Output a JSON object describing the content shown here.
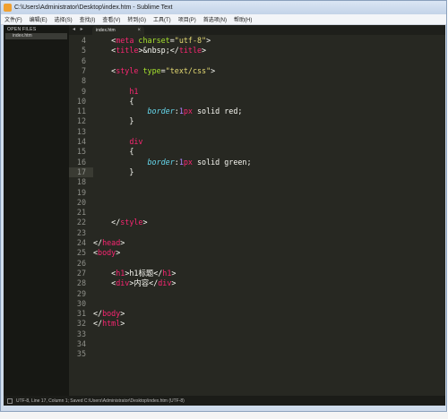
{
  "window": {
    "title": "C:\\Users\\Administrator\\Desktop\\index.htm - Sublime Text"
  },
  "menu": [
    "文件(F)",
    "编辑(E)",
    "选择(S)",
    "查找(I)",
    "查看(V)",
    "转到(G)",
    "工具(T)",
    "项目(P)",
    "首选项(N)",
    "帮助(H)"
  ],
  "sidebar": {
    "header": "OPEN FILES",
    "files": [
      "index.htm"
    ]
  },
  "tabs": {
    "arrows": "◂ ▸",
    "active": "index.htm",
    "close": "×"
  },
  "editor": {
    "current_line": 17,
    "lines": [
      {
        "n": "4",
        "tokens": [
          {
            "t": "    ",
            "c": "plain"
          },
          {
            "t": "<",
            "c": "plain"
          },
          {
            "t": "meta",
            "c": "tag"
          },
          {
            "t": " charset",
            "c": "attr"
          },
          {
            "t": "=",
            "c": "plain"
          },
          {
            "t": "\"utf-8\"",
            "c": "str"
          },
          {
            "t": ">",
            "c": "plain"
          }
        ]
      },
      {
        "n": "5",
        "tokens": [
          {
            "t": "    ",
            "c": "plain"
          },
          {
            "t": "<",
            "c": "plain"
          },
          {
            "t": "title",
            "c": "tag"
          },
          {
            "t": ">&nbsp;</",
            "c": "plain"
          },
          {
            "t": "title",
            "c": "tag"
          },
          {
            "t": ">",
            "c": "plain"
          }
        ]
      },
      {
        "n": "6",
        "tokens": []
      },
      {
        "n": "7",
        "tokens": [
          {
            "t": "    ",
            "c": "plain"
          },
          {
            "t": "<",
            "c": "plain"
          },
          {
            "t": "style",
            "c": "tag"
          },
          {
            "t": " type",
            "c": "attr"
          },
          {
            "t": "=",
            "c": "plain"
          },
          {
            "t": "\"text/css\"",
            "c": "str"
          },
          {
            "t": ">",
            "c": "plain"
          }
        ]
      },
      {
        "n": "8",
        "tokens": []
      },
      {
        "n": "9",
        "tokens": [
          {
            "t": "        ",
            "c": "plain"
          },
          {
            "t": "h1",
            "c": "tag"
          }
        ]
      },
      {
        "n": "10",
        "tokens": [
          {
            "t": "        {",
            "c": "plain"
          }
        ]
      },
      {
        "n": "11",
        "tokens": [
          {
            "t": "            ",
            "c": "plain"
          },
          {
            "t": "border",
            "c": "prop"
          },
          {
            "t": ":",
            "c": "plain"
          },
          {
            "t": "1",
            "c": "num"
          },
          {
            "t": "px",
            "c": "tag"
          },
          {
            "t": " solid red;",
            "c": "plain"
          }
        ]
      },
      {
        "n": "12",
        "tokens": [
          {
            "t": "        }",
            "c": "plain"
          }
        ]
      },
      {
        "n": "13",
        "tokens": []
      },
      {
        "n": "14",
        "tokens": [
          {
            "t": "        ",
            "c": "plain"
          },
          {
            "t": "div",
            "c": "tag"
          }
        ]
      },
      {
        "n": "15",
        "tokens": [
          {
            "t": "        {",
            "c": "plain"
          }
        ]
      },
      {
        "n": "16",
        "tokens": [
          {
            "t": "            ",
            "c": "plain"
          },
          {
            "t": "border",
            "c": "prop"
          },
          {
            "t": ":",
            "c": "plain"
          },
          {
            "t": "1",
            "c": "num"
          },
          {
            "t": "px",
            "c": "tag"
          },
          {
            "t": " solid green;",
            "c": "plain"
          }
        ]
      },
      {
        "n": "17",
        "tokens": [
          {
            "t": "        }",
            "c": "plain"
          }
        ]
      },
      {
        "n": "18",
        "tokens": []
      },
      {
        "n": "19",
        "tokens": []
      },
      {
        "n": "20",
        "tokens": []
      },
      {
        "n": "21",
        "tokens": []
      },
      {
        "n": "22",
        "tokens": [
          {
            "t": "    ",
            "c": "plain"
          },
          {
            "t": "</",
            "c": "plain"
          },
          {
            "t": "style",
            "c": "tag"
          },
          {
            "t": ">",
            "c": "plain"
          }
        ]
      },
      {
        "n": "23",
        "tokens": []
      },
      {
        "n": "24",
        "tokens": [
          {
            "t": "</",
            "c": "plain"
          },
          {
            "t": "head",
            "c": "tag"
          },
          {
            "t": ">",
            "c": "plain"
          }
        ]
      },
      {
        "n": "25",
        "tokens": [
          {
            "t": "<",
            "c": "plain"
          },
          {
            "t": "body",
            "c": "tag"
          },
          {
            "t": ">",
            "c": "plain"
          }
        ]
      },
      {
        "n": "26",
        "tokens": []
      },
      {
        "n": "27",
        "tokens": [
          {
            "t": "    ",
            "c": "plain"
          },
          {
            "t": "<",
            "c": "plain"
          },
          {
            "t": "h1",
            "c": "tag"
          },
          {
            "t": ">h1标题</",
            "c": "plain"
          },
          {
            "t": "h1",
            "c": "tag"
          },
          {
            "t": ">",
            "c": "plain"
          }
        ]
      },
      {
        "n": "28",
        "tokens": [
          {
            "t": "    ",
            "c": "plain"
          },
          {
            "t": "<",
            "c": "plain"
          },
          {
            "t": "div",
            "c": "tag"
          },
          {
            "t": ">内容</",
            "c": "plain"
          },
          {
            "t": "div",
            "c": "tag"
          },
          {
            "t": ">",
            "c": "plain"
          }
        ]
      },
      {
        "n": "29",
        "tokens": []
      },
      {
        "n": "30",
        "tokens": []
      },
      {
        "n": "31",
        "tokens": [
          {
            "t": "</",
            "c": "plain"
          },
          {
            "t": "body",
            "c": "tag"
          },
          {
            "t": ">",
            "c": "plain"
          }
        ]
      },
      {
        "n": "32",
        "tokens": [
          {
            "t": "</",
            "c": "plain"
          },
          {
            "t": "html",
            "c": "tag"
          },
          {
            "t": ">",
            "c": "plain"
          }
        ]
      },
      {
        "n": "33",
        "tokens": []
      },
      {
        "n": "34",
        "tokens": []
      },
      {
        "n": "35",
        "tokens": []
      }
    ]
  },
  "status": {
    "text": "UTF-8, Line 17, Column 1; Saved C:\\Users\\Administrator\\Desktop\\index.htm (UTF-8)"
  },
  "colors": {
    "tag": "#f92672",
    "attr": "#a6e22e",
    "string": "#e6db74",
    "property": "#66d9ef",
    "number": "#ae81ff",
    "background": "#272822"
  }
}
